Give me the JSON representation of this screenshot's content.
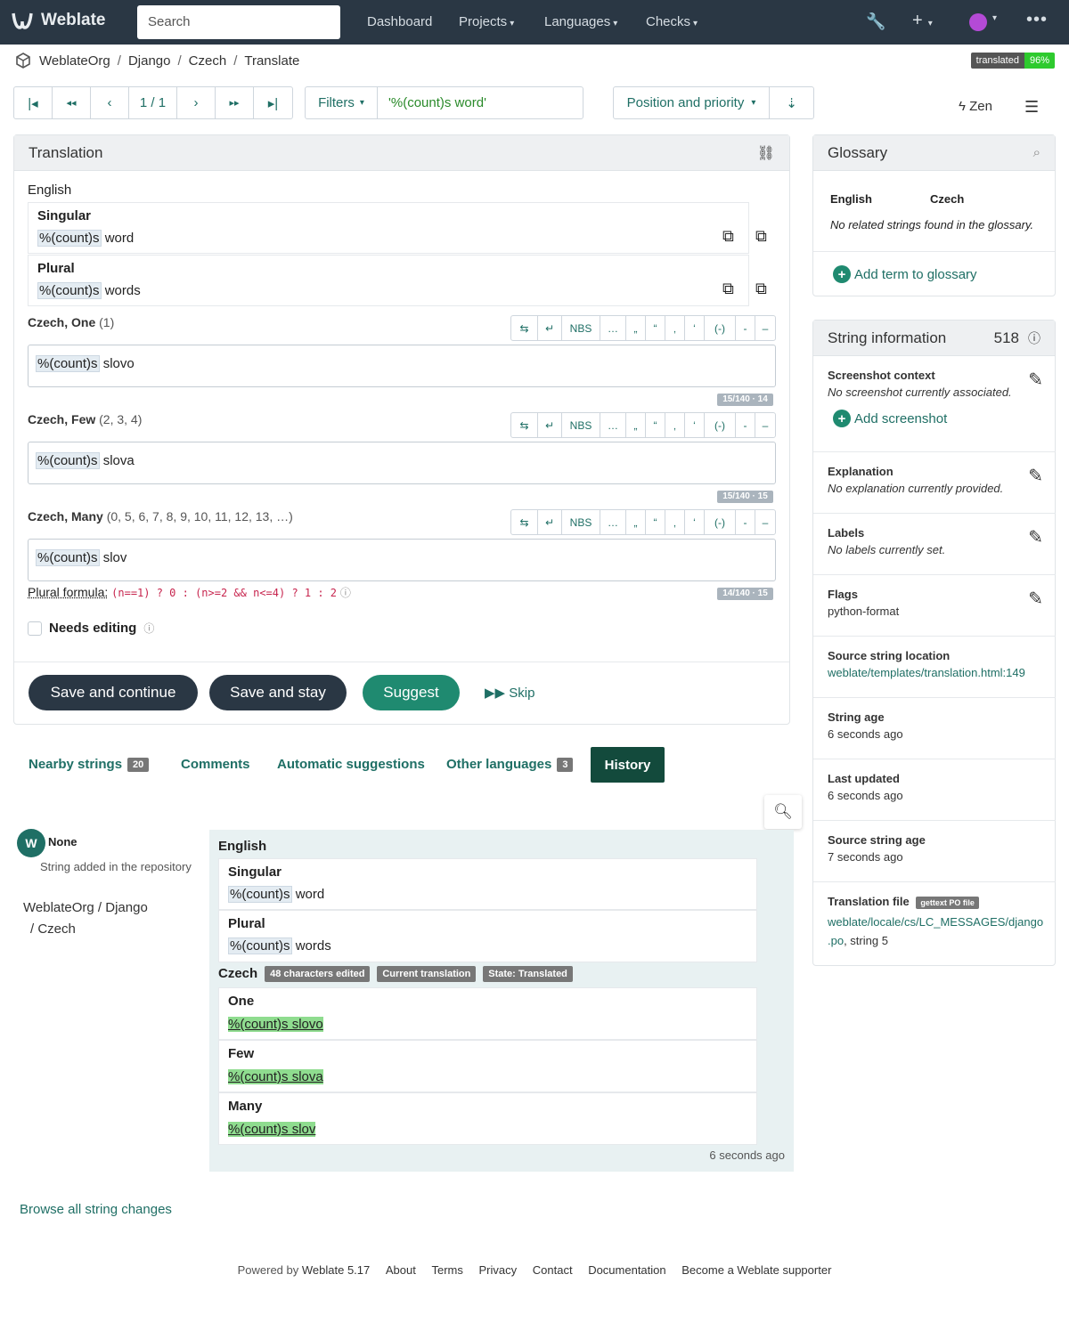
{
  "nav": {
    "brand": "Weblate",
    "search_placeholder": "Search",
    "menus": [
      "Dashboard",
      "Projects",
      "Languages",
      "Checks"
    ]
  },
  "breadcrumb": [
    "WeblateOrg",
    "Django",
    "Czech",
    "Translate"
  ],
  "status_badge": {
    "label": "translated",
    "value": "96%"
  },
  "pager": {
    "position": "1 / 1"
  },
  "filters": {
    "label": "Filters",
    "query": "'%(count)s word'"
  },
  "sort": {
    "label": "Position and priority"
  },
  "zen_label": "Zen",
  "translation_panel": {
    "title": "Translation",
    "source_lang": "English",
    "singular_label": "Singular",
    "singular_placeholder": "%(count)s",
    "singular_rest": " word",
    "plural_label": "Plural",
    "plural_placeholder": "%(count)s",
    "plural_rest": " words",
    "forms": [
      {
        "name": "Czech, One",
        "numbers": "(1)",
        "placeholder": "%(count)s",
        "rest": " slovo",
        "counter": "15/140 · 14"
      },
      {
        "name": "Czech, Few",
        "numbers": "(2, 3, 4)",
        "placeholder": "%(count)s",
        "rest": " slova",
        "counter": "15/140 · 15"
      },
      {
        "name": "Czech, Many",
        "numbers": "(0, 5, 6, 7, 8, 9, 10, 11, 12, 13, …)",
        "placeholder": "%(count)s",
        "rest": " slov",
        "counter": "14/140 · 15"
      }
    ],
    "toolbar_keys": [
      "⇆",
      "↵",
      "NBS",
      "…",
      "„",
      "“",
      "‚",
      "‘",
      "(-)",
      "-",
      "–"
    ],
    "plural_formula_label": "Plural formula:",
    "plural_formula": "(n==1) ? 0 : (n>=2 && n<=4) ? 1 : 2",
    "needs_editing": "Needs editing",
    "save_continue": "Save and continue",
    "save_stay": "Save and stay",
    "suggest": "Suggest",
    "skip": "Skip"
  },
  "tabs": [
    {
      "label": "Nearby strings",
      "count": "20"
    },
    {
      "label": "Comments"
    },
    {
      "label": "Automatic suggestions"
    },
    {
      "label": "Other languages",
      "count": "3"
    },
    {
      "label": "History"
    }
  ],
  "history": {
    "user": "None",
    "action": "String added in the repository",
    "path1": "WeblateOrg / Django",
    "path2": "/ Czech",
    "source_lang": "English",
    "singular_label": "Singular",
    "singular_placeholder": "%(count)s",
    "singular_rest": " word",
    "plural_label": "Plural",
    "plural_placeholder": "%(count)s",
    "plural_rest": " words",
    "target_lang": "Czech",
    "chips": [
      "48 characters edited",
      "Current translation",
      "State: Translated"
    ],
    "forms": [
      {
        "label": "One",
        "text": "%(count)s slovo"
      },
      {
        "label": "Few",
        "text": "%(count)s slova"
      },
      {
        "label": "Many",
        "text": "%(count)s slov"
      }
    ],
    "time": "6 seconds ago"
  },
  "browse_all": "Browse all string changes",
  "glossary": {
    "title": "Glossary",
    "col_source": "English",
    "col_target": "Czech",
    "empty": "No related strings found in the glossary.",
    "add_term": "Add term to glossary"
  },
  "string_info": {
    "title": "String information",
    "id": "518",
    "screenshot_title": "Screenshot context",
    "screenshot_value": "No screenshot currently associated.",
    "add_screenshot": "Add screenshot",
    "explanation_title": "Explanation",
    "explanation_value": "No explanation currently provided.",
    "labels_title": "Labels",
    "labels_value": "No labels currently set.",
    "flags_title": "Flags",
    "flags_value": "python-format",
    "location_title": "Source string location",
    "location_value": "weblate/templates/translation.html:149",
    "age_title": "String age",
    "age_value": "6 seconds ago",
    "updated_title": "Last updated",
    "updated_value": "6 seconds ago",
    "source_age_title": "Source string age",
    "source_age_value": "7 seconds ago",
    "file_title": "Translation file",
    "file_chip": "gettext PO file",
    "file_link1": "weblate/locale/cs/LC_MESSAGES/django",
    "file_link2": ".po",
    "file_suffix": ", string 5"
  },
  "footer": {
    "powered": "Powered by",
    "version": "Weblate 5.17",
    "links": [
      "About",
      "Terms",
      "Privacy",
      "Contact",
      "Documentation",
      "Become a Weblate supporter"
    ]
  },
  "colors": {
    "nav": "#2a3744",
    "accent": "#1f6f65",
    "suggest": "#1f8a70",
    "badge_green": "#2eca2e"
  }
}
